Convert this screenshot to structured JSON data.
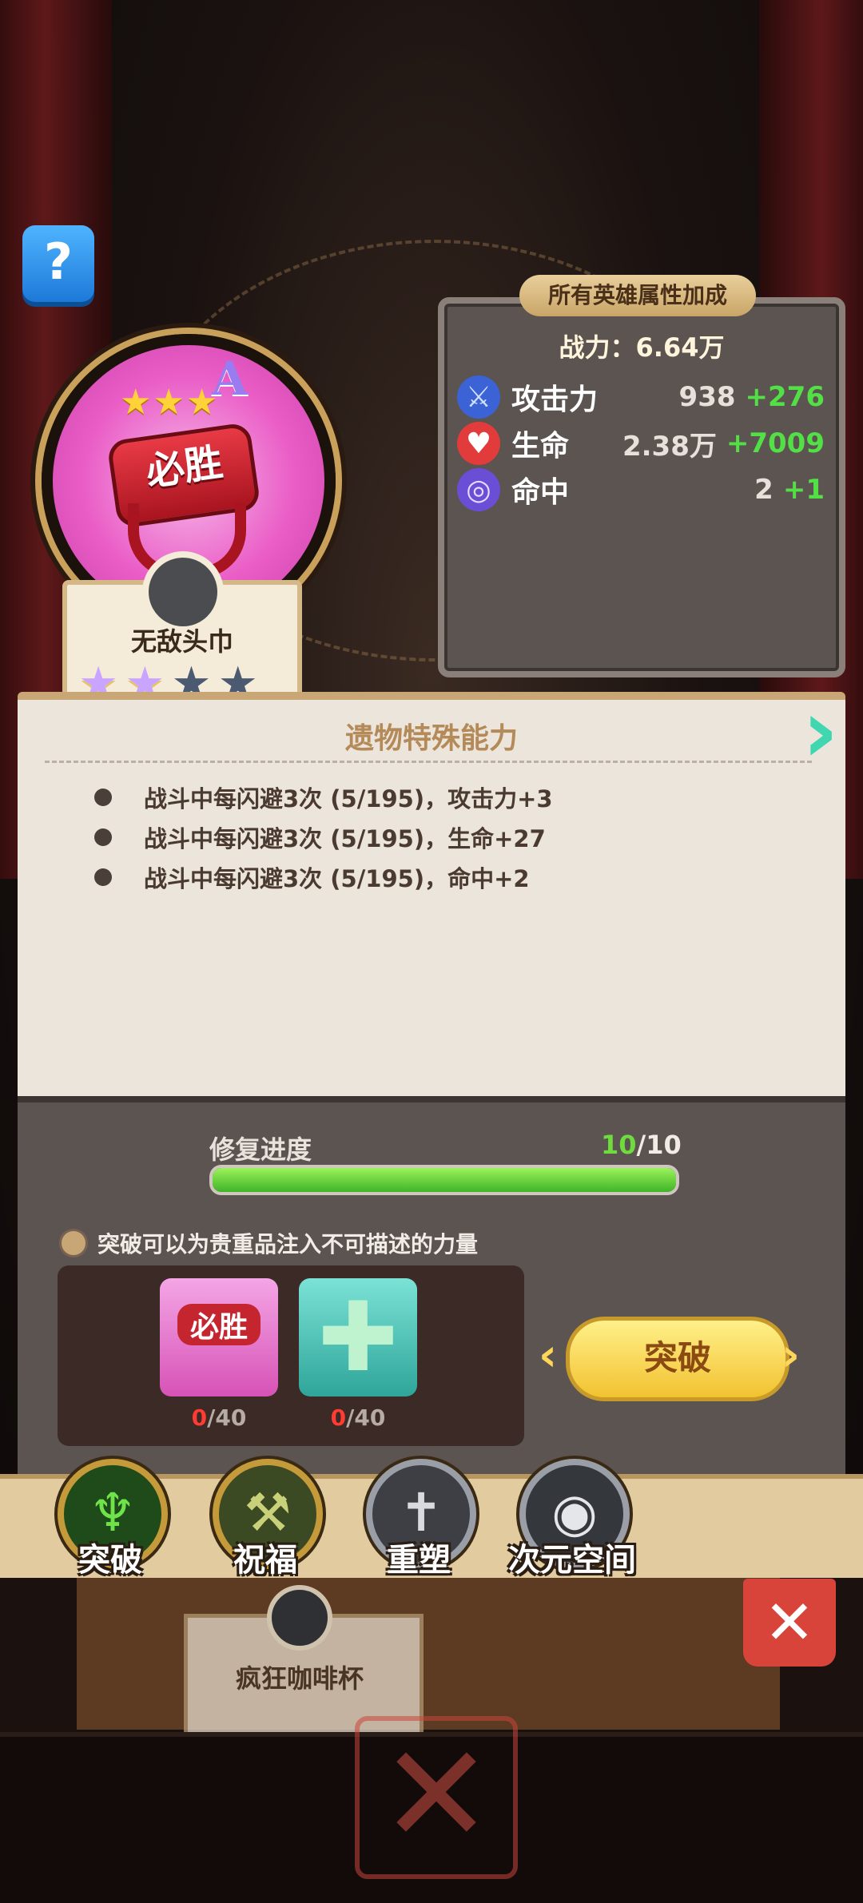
{
  "relic": {
    "name": "无敌头巾",
    "grade": "A",
    "emblem_text": "必胜",
    "stars": [
      true,
      true,
      false,
      false
    ]
  },
  "stats_panel": {
    "header": "所有英雄属性加成",
    "power": "战力：6.64万",
    "rows": [
      {
        "icon": "sword-icon",
        "name": "攻击力",
        "value": "938",
        "bonus": "+276"
      },
      {
        "icon": "heart-icon",
        "name": "生命",
        "value": "2.38万",
        "bonus": "+7009"
      },
      {
        "icon": "target-icon",
        "name": "命中",
        "value": "2",
        "bonus": "+1"
      }
    ]
  },
  "ability": {
    "title": "遗物特殊能力",
    "items": [
      "战斗中每闪避3次 (5/195)，攻击力+3",
      "战斗中每闪避3次 (5/195)，生命+27",
      "战斗中每闪避3次 (5/195)，命中+2"
    ]
  },
  "repair": {
    "label": "修复进度",
    "current": "10",
    "total": "/10",
    "progress": 1.0
  },
  "breakthrough": {
    "hint": "突破可以为贵重品注入不可描述的力量",
    "materials": [
      {
        "have": "0",
        "need": "/40",
        "icon": "relic-material-icon"
      },
      {
        "have": "0",
        "need": "/40",
        "icon": "clover-material-icon"
      }
    ],
    "button": "突破"
  },
  "tabs": [
    {
      "label": "突破",
      "icon": "claw-icon",
      "color": "#2f7a2a"
    },
    {
      "label": "祝福",
      "icon": "hammer-icon",
      "color": "#556b2f"
    },
    {
      "label": "重塑",
      "icon": "anvil-icon",
      "color": "#555a60"
    },
    {
      "label": "次元空间",
      "icon": "planet-icon",
      "color": "#44484e"
    }
  ],
  "lower": {
    "shelf_name": "疯狂咖啡杯"
  }
}
